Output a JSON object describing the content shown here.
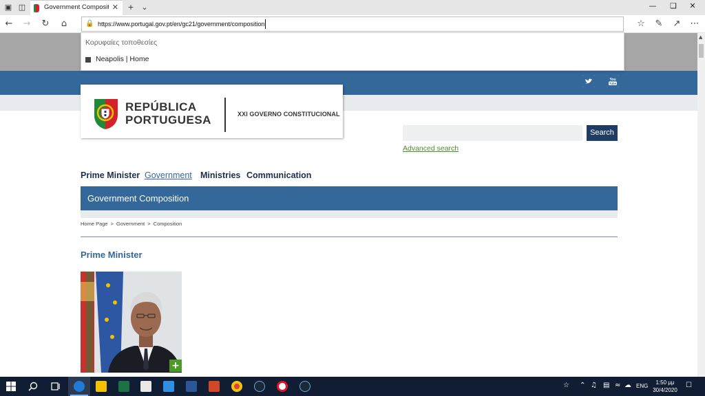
{
  "browser": {
    "tab_title": "Government Compositio",
    "url": "https://www.portugal.gov.pt/en/gc21/government/composition",
    "dropdown": {
      "heading": "Κορυφαίες τοποθεσίες",
      "items": [
        {
          "label": "Neapolis | Home"
        }
      ]
    }
  },
  "header": {
    "logo_line1": "REPÚBLICA",
    "logo_line2": "PORTUGUESA",
    "logo_subtitle": "XXI GOVERNO CONSTITUCIONAL",
    "search_button": "Search",
    "advanced_search": "Advanced search"
  },
  "nav": [
    {
      "label": "Prime Minister",
      "active": false
    },
    {
      "label": "Government",
      "active": true
    },
    {
      "label": "Ministries",
      "active": false
    },
    {
      "label": "Communication",
      "active": false
    }
  ],
  "page": {
    "title": "Government Composition",
    "breadcrumb": [
      "Home Page",
      "Government",
      "Composition"
    ],
    "section_title": "Prime Minister",
    "photo_plus": "+"
  },
  "taskbar": {
    "language": "ENG",
    "time": "1:50 μμ",
    "date": "30/4/2020"
  },
  "colors": {
    "primary_blue": "#34679a",
    "dark_navy": "#1f3d63",
    "link_green": "#4c8c2b",
    "taskbar": "#101d33"
  }
}
